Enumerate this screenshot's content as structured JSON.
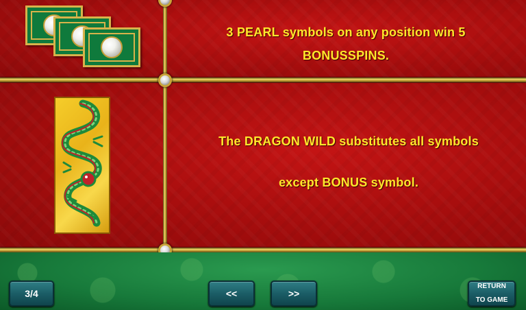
{
  "pages": [
    {
      "symbol": "pearl-scatter-symbol",
      "description": "3 PEARL symbols on any position win 5 BONUSSPINS."
    },
    {
      "symbol": "dragon-wild-symbol",
      "description_line1": "The DRAGON WILD substitutes all symbols",
      "description_line2": "except BONUS symbol."
    }
  ],
  "nav": {
    "page_indicator": "3/4",
    "prev_label": "<<",
    "next_label": ">>",
    "return_label_line1": "RETURN",
    "return_label_line2": "TO GAME"
  },
  "colors": {
    "text_yellow": "#ffe62b",
    "panel_red": "#a50d0d",
    "bottom_green": "#17793a",
    "button_teal": "#1b5d66",
    "gold_border": "#d8b34a"
  }
}
